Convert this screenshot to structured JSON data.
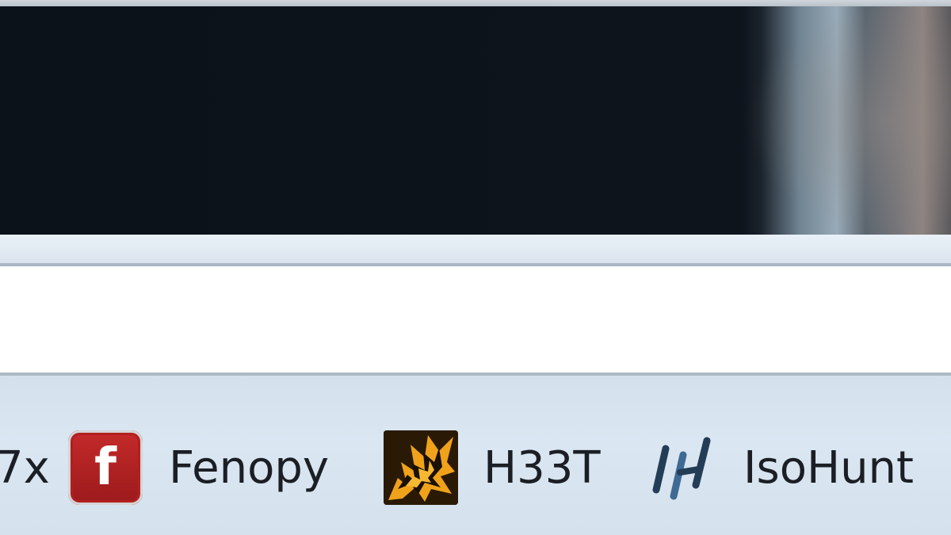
{
  "bookmarks_bar": {
    "partial_item_label": "7x",
    "items": [
      {
        "label": "Fenopy",
        "icon": "fenopy-icon",
        "icon_glyph": "f"
      },
      {
        "label": "H33T",
        "icon": "h33t-icon"
      },
      {
        "label": "IsoHunt",
        "icon": "isohunt-icon"
      }
    ]
  },
  "colors": {
    "fenopy_red": "#b32225",
    "h33t_orange": "#f0a21a",
    "isohunt_blue": "#243d57",
    "bar_background": "#d8e4ef"
  }
}
